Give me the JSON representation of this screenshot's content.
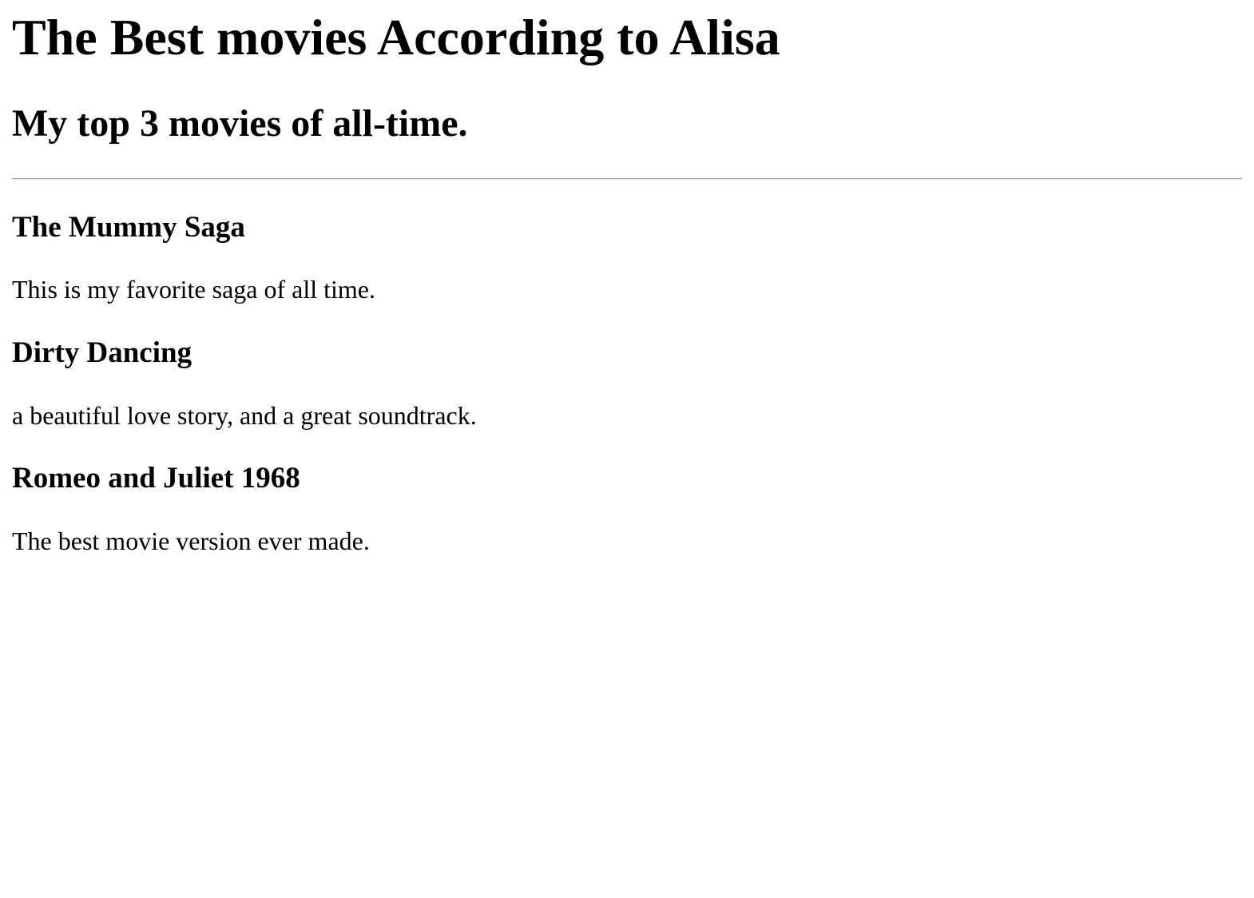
{
  "header": {
    "title": "The Best movies According to Alisa",
    "subtitle": "My top 3 movies of all-time."
  },
  "movies": [
    {
      "title": "The Mummy Saga",
      "description": "This is my favorite saga of all time."
    },
    {
      "title": "Dirty Dancing",
      "description": "a beautiful love story, and a great soundtrack."
    },
    {
      "title": "Romeo and Juliet 1968",
      "description": "The best movie version ever made."
    }
  ]
}
